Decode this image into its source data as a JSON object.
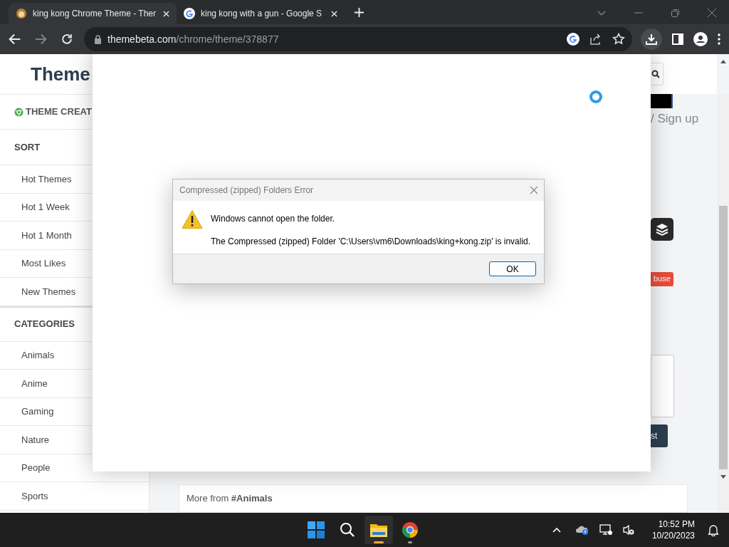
{
  "browser": {
    "tabs": [
      {
        "kind": "site",
        "title": "king kong Chrome Theme - Ther",
        "selected": true
      },
      {
        "kind": "google",
        "title": "king kong with a gun - Google S",
        "selected": false
      }
    ],
    "address": {
      "host": "themebeta.com",
      "path": "/chrome/theme/378877"
    }
  },
  "page": {
    "logo": "Theme",
    "theme_creator": "THEME CREAT",
    "sort": {
      "heading": "SORT",
      "items": [
        "Hot Themes",
        "Hot 1 Week",
        "Hot 1 Month",
        "Most Likes",
        "New Themes"
      ]
    },
    "categories": {
      "heading": "CATEGORIES",
      "items": [
        "Animals",
        "Anime",
        "Gaming",
        "Nature",
        "People",
        "Sports"
      ]
    },
    "sign_up": "/ Sign up",
    "report_button": "buse",
    "submit_button": "st",
    "more_from": "More from **#Animals**"
  },
  "dialog": {
    "title": "Compressed (zipped) Folders Error",
    "heading": "Windows cannot open the folder.",
    "message": "The Compressed (zipped) Folder 'C:\\Users\\vm6\\Downloads\\king+kong.zip' is invalid.",
    "button": "OK"
  },
  "taskbar": {
    "apps": [
      {
        "kind": "start",
        "selected": false,
        "running": false
      },
      {
        "kind": "search",
        "selected": false,
        "running": false
      },
      {
        "kind": "explorer",
        "selected": true,
        "running": true
      },
      {
        "kind": "chrome",
        "selected": false,
        "running": true
      }
    ],
    "time": "10:52 PM",
    "date": "10/20/2023"
  }
}
